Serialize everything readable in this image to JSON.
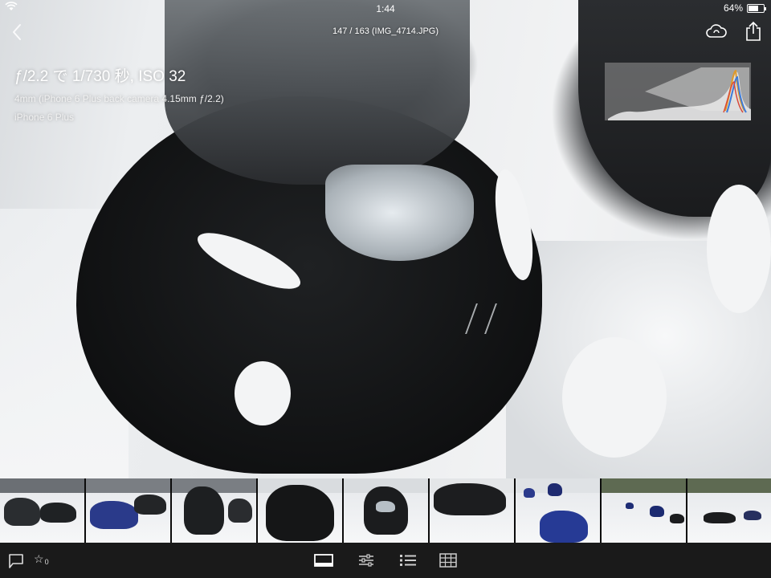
{
  "status_bar": {
    "time": "1:44",
    "battery": "64%",
    "battery_level": 0.64
  },
  "header": {
    "counter": "147 / 163 (IMG_4714.JPG)"
  },
  "info": {
    "exposure": "ƒ/2.2 で 1/730 秒, ISO 32",
    "lens": "4mm (iPhone 6 Plus back camera 4.15mm ƒ/2.2)",
    "camera": "iPhone 6 Plus"
  },
  "icons": {
    "back": "chevron-left-icon",
    "cloud": "cloud-sync-icon",
    "share": "share-icon",
    "flag": "flag-icon",
    "star": "star-icon",
    "loupe": "single-view-icon",
    "adjust": "sliders-icon",
    "list": "list-icon",
    "grid": "grid-icon"
  },
  "toolbar": {
    "star_glyph": "☆",
    "rating_count": "0"
  },
  "filmstrip": {
    "selected_index": 4,
    "count": 9
  },
  "colors": {
    "toolbar_bg": "#1a1a1a",
    "filmstrip_bg": "#0b0b0b",
    "histogram_bg": "#969696"
  }
}
